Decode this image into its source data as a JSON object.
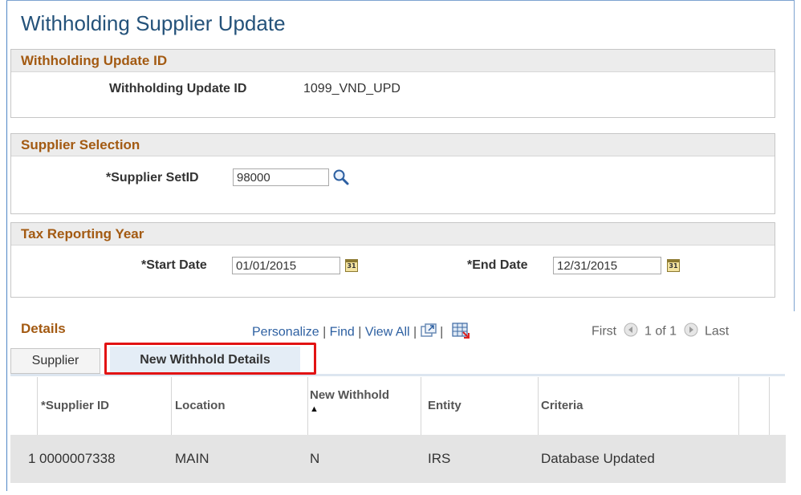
{
  "page": {
    "title": "Withholding Supplier Update"
  },
  "update_section": {
    "header": "Withholding Update ID",
    "label": "Withholding Update ID",
    "value": "1099_VND_UPD"
  },
  "supplier_section": {
    "header": "Supplier Selection",
    "setid_label": "*Supplier SetID",
    "setid_value": "98000"
  },
  "tax_section": {
    "header": "Tax Reporting Year",
    "start_label": "*Start Date",
    "start_value": "01/01/2015",
    "end_label": "*End Date",
    "end_value": "12/31/2015",
    "calendar_glyph": "31"
  },
  "details": {
    "title": "Details",
    "personalize": "Personalize",
    "find": "Find",
    "view_all": "View All",
    "sep": "|",
    "first": "First",
    "count": "1 of 1",
    "last": "Last"
  },
  "tabs": [
    {
      "label": "Supplier",
      "active": false
    },
    {
      "label": "New Withhold Details",
      "active": true
    }
  ],
  "grid": {
    "columns": [
      "*Supplier ID",
      "Location",
      "New Withhold",
      "Entity",
      "Criteria"
    ],
    "sort_indicator": "▲",
    "rows": [
      {
        "num": "1",
        "supplier_id": "0000007338",
        "location": "MAIN",
        "new_withhold": "N",
        "entity": "IRS",
        "criteria": "Database Updated"
      }
    ]
  },
  "colors": {
    "title_blue": "#24527a",
    "section_orange": "#a35a12",
    "link_blue": "#2c5fa1",
    "highlight_red": "#e21313"
  }
}
